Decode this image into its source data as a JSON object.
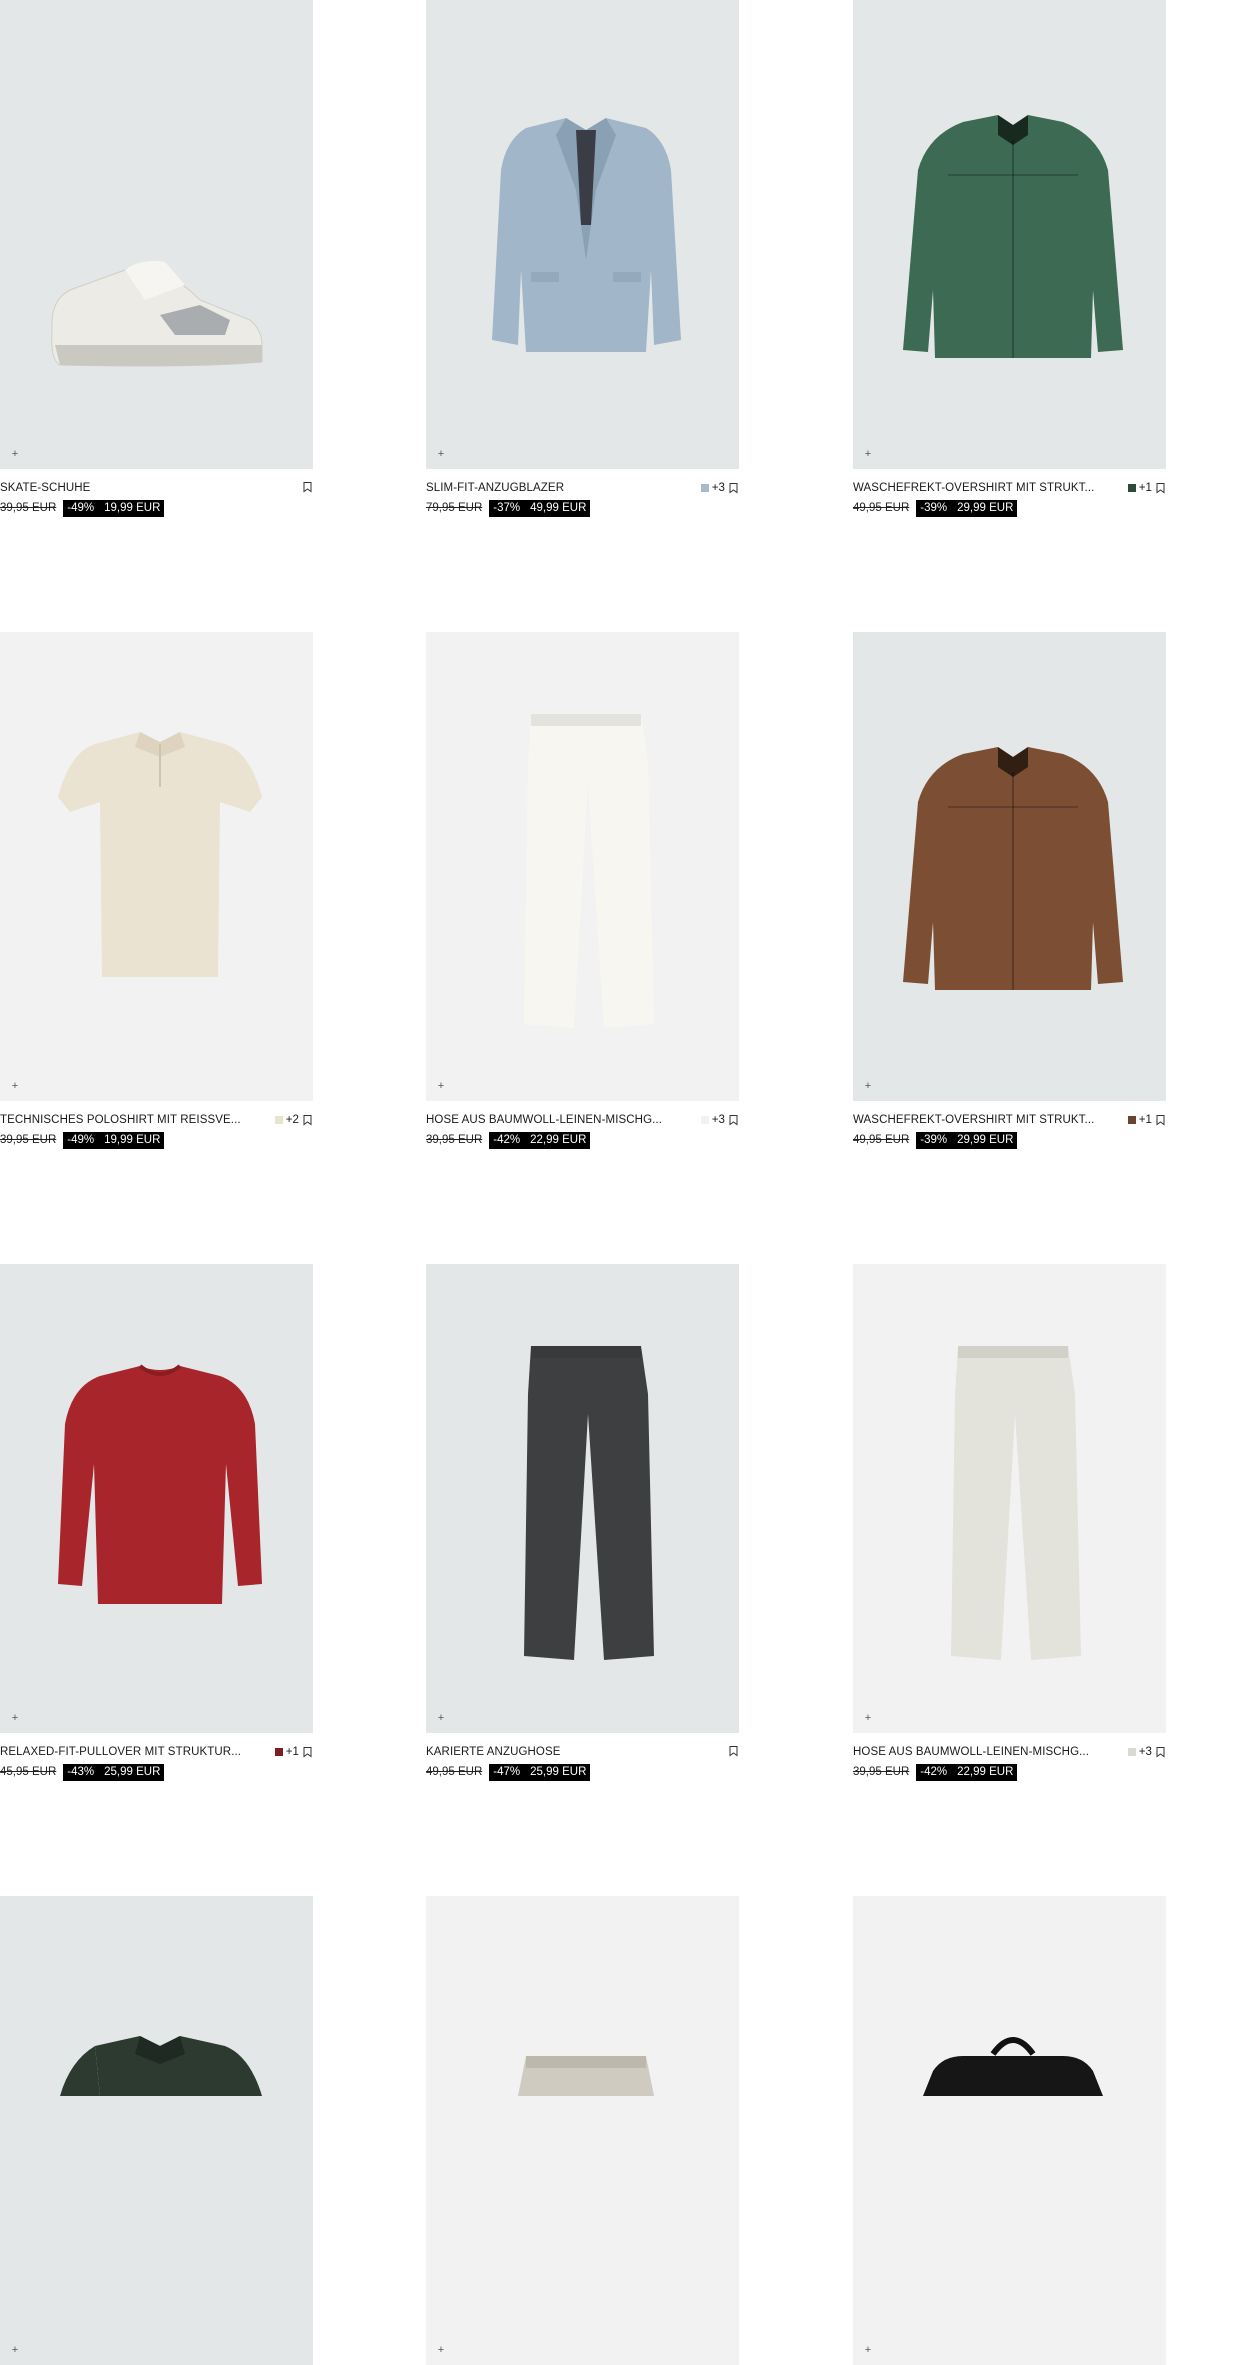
{
  "products": [
    {
      "name": "SKATE-SCHUHE",
      "swatch": null,
      "more": "",
      "old_price": "39,95 EUR",
      "discount": "-49%",
      "price": "19,99 EUR",
      "bg": "blue",
      "icon": "sneaker"
    },
    {
      "name": "SLIM-FIT-ANZUGBLAZER",
      "swatch": "#a9b9c6",
      "more": "+3",
      "old_price": "79,95 EUR",
      "discount": "-37%",
      "price": "49,99 EUR",
      "bg": "blue",
      "icon": "blazer"
    },
    {
      "name": "WASCHEFREKT-OVERSHIRT MIT STRUKT...",
      "swatch": "#2e4a3a",
      "more": "+1",
      "old_price": "49,95 EUR",
      "discount": "-39%",
      "price": "29,99 EUR",
      "bg": "blue",
      "icon": "overshirt-green"
    },
    {
      "name": "TECHNISCHES POLOSHIRT MIT REISSVE...",
      "swatch": "#e8e2cf",
      "more": "+2",
      "old_price": "39,95 EUR",
      "discount": "-49%",
      "price": "19,99 EUR",
      "bg": "light",
      "icon": "polo"
    },
    {
      "name": "HOSE AUS BAUMWOLL-LEINEN-MISCHG...",
      "swatch": "#f3f1ea",
      "more": "+3",
      "old_price": "39,95 EUR",
      "discount": "-42%",
      "price": "22,99 EUR",
      "bg": "light",
      "icon": "pants-white"
    },
    {
      "name": "WASCHEFREKT-OVERSHIRT MIT STRUKT...",
      "swatch": "#6b4430",
      "more": "+1",
      "old_price": "49,95 EUR",
      "discount": "-39%",
      "price": "29,99 EUR",
      "bg": "blue",
      "icon": "overshirt-brown"
    },
    {
      "name": "RELAXED-FIT-PULLOVER MIT STRUKTUR...",
      "swatch": "#7a1f24",
      "more": "+1",
      "old_price": "45,95 EUR",
      "discount": "-43%",
      "price": "25,99 EUR",
      "bg": "blue",
      "icon": "sweater"
    },
    {
      "name": "KARIERTE ANZUGHOSE",
      "swatch": null,
      "more": "",
      "old_price": "49,95 EUR",
      "discount": "-47%",
      "price": "25,99 EUR",
      "bg": "blue",
      "icon": "pants-grey"
    },
    {
      "name": "HOSE AUS BAUMWOLL-LEINEN-MISCHG...",
      "swatch": "#d9d9d4",
      "more": "+3",
      "old_price": "39,95 EUR",
      "discount": "-42%",
      "price": "22,99 EUR",
      "bg": "light",
      "icon": "pants-stone"
    },
    {
      "bg": "blue",
      "icon": "polo-green"
    },
    {
      "bg": "light",
      "icon": "shorts"
    },
    {
      "bg": "light",
      "icon": "bag"
    }
  ],
  "ui": {
    "add_symbol": "+"
  }
}
